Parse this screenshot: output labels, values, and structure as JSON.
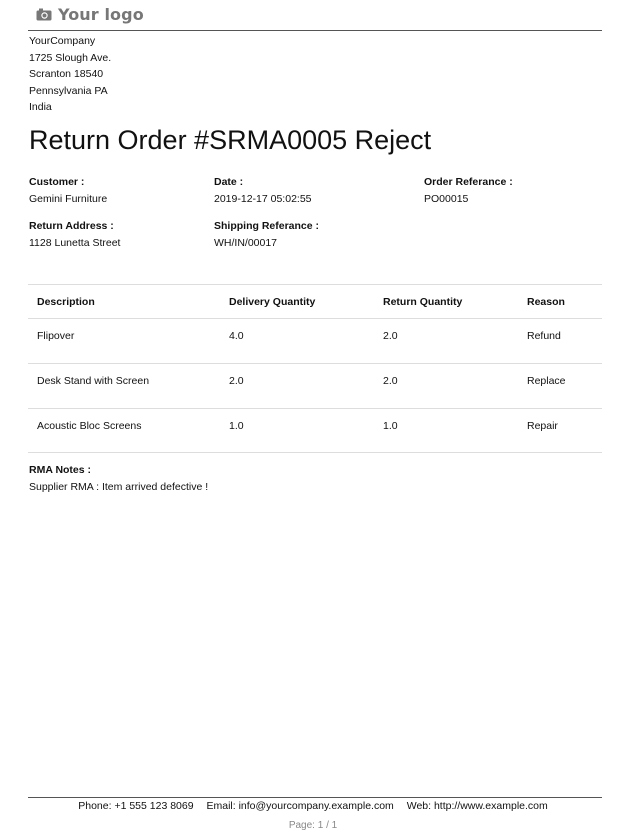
{
  "header": {
    "logo_icon": "camera-icon",
    "logo_text": "Your logo"
  },
  "company": {
    "name": "YourCompany",
    "street": "1725 Slough Ave.",
    "city_zip": "Scranton 18540",
    "state": "Pennsylvania PA",
    "country": "India"
  },
  "title": "Return Order #SRMA0005  Reject",
  "info": {
    "customer_label": "Customer :",
    "customer_value": "Gemini Furniture",
    "date_label": "Date :",
    "date_value": "2019-12-17 05:02:55",
    "order_ref_label": "Order Referance :",
    "order_ref_value": "PO00015",
    "return_address_label": "Return Address :",
    "return_address_value": "1128 Lunetta Street",
    "shipping_ref_label": "Shipping Referance :",
    "shipping_ref_value": "WH/IN/00017"
  },
  "lines": {
    "headers": [
      "Description",
      "Delivery Quantity",
      "Return Quantity",
      "Reason"
    ],
    "rows": [
      [
        "Flipover",
        "4.0",
        "2.0",
        "Refund"
      ],
      [
        "Desk Stand with Screen",
        "2.0",
        "2.0",
        "Replace"
      ],
      [
        "Acoustic Bloc Screens",
        "1.0",
        "1.0",
        "Repair"
      ]
    ]
  },
  "notes": {
    "label": "RMA Notes :",
    "text": "Supplier RMA : Item arrived defective !"
  },
  "footer": {
    "phone": "Phone: +1 555 123 8069",
    "email": "Email: info@yourcompany.example.com",
    "web": "Web: http://www.example.com",
    "page": "Page: 1 / 1"
  }
}
